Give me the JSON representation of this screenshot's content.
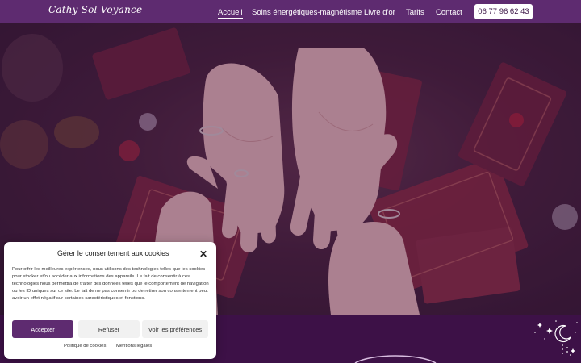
{
  "header": {
    "logo": "Cathy Sol Voyance",
    "nav": [
      "Accueil",
      "Soins énergétiques-magnétisme",
      "Livre d'or",
      "Tarifs",
      "Contact"
    ],
    "phone": "06 77 96 62 43"
  },
  "colors": {
    "header": "#5e2b70",
    "band": "#3d1147",
    "accept": "#5e2b70"
  },
  "cookie_modal": {
    "title": "Gérer le consentement aux cookies",
    "body": "Pour offrir les meilleures expériences, nous utilisons des technologies telles que les cookies pour stocker et/ou accéder aux informations des appareils. Le fait de consentir à ces technologies nous permettra de traiter des données telles que le comportement de navigation ou les ID uniques sur ce site. Le fait de ne pas consentir ou de retirer son consentement peut avoir un effet négatif sur certaines caractéristiques et fonctions.",
    "accept": "Accepter",
    "refuse": "Refuser",
    "preferences": "Voir les préférences",
    "links": [
      "Politique de cookies",
      "Mentions légales"
    ]
  }
}
